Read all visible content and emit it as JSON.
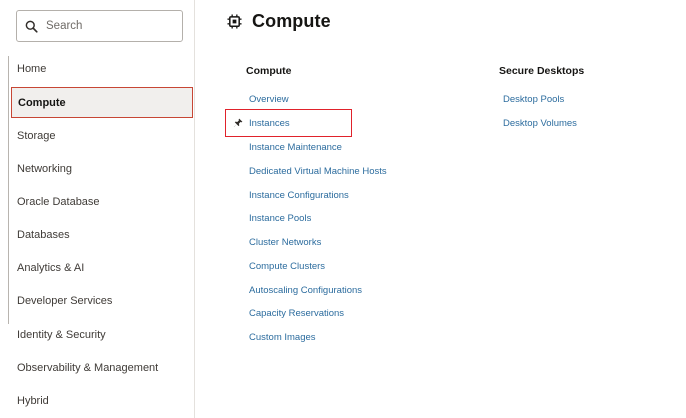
{
  "sidebar": {
    "search_placeholder": "Search",
    "items": [
      {
        "label": "Home"
      },
      {
        "label": "Compute"
      },
      {
        "label": "Storage"
      },
      {
        "label": "Networking"
      },
      {
        "label": "Oracle Database"
      },
      {
        "label": "Databases"
      },
      {
        "label": "Analytics & AI"
      },
      {
        "label": "Developer Services"
      },
      {
        "label": "Identity & Security"
      },
      {
        "label": "Observability & Management"
      },
      {
        "label": "Hybrid"
      }
    ]
  },
  "main": {
    "title": "Compute",
    "title_icon": "chip-icon",
    "columns": [
      {
        "heading": "Compute",
        "links": [
          "Overview",
          "Instances",
          "Instance Maintenance",
          "Dedicated Virtual Machine Hosts",
          "Instance Configurations",
          "Instance Pools",
          "Cluster Networks",
          "Compute Clusters",
          "Autoscaling Configurations",
          "Capacity Reservations",
          "Custom Images"
        ]
      },
      {
        "heading": "Secure Desktops",
        "links": [
          "Desktop Pools",
          "Desktop Volumes"
        ]
      }
    ],
    "pinned_icon": "pin-icon"
  },
  "colors": {
    "link": "#2c6c9e",
    "highlight": "#e0222b",
    "active_bg": "#f1efed"
  }
}
